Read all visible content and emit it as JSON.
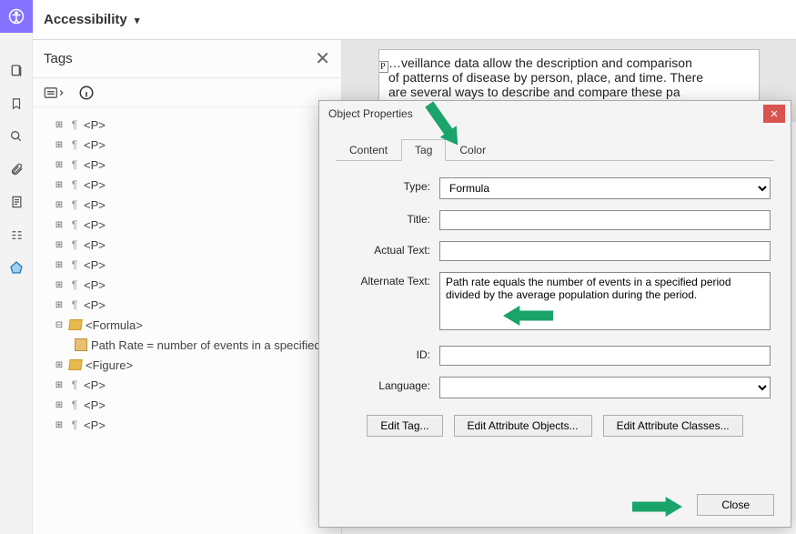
{
  "top": {
    "title": "Accessibility"
  },
  "tags_panel": {
    "heading": "Tags",
    "items": [
      {
        "kind": "p",
        "label": "<P>"
      },
      {
        "kind": "p",
        "label": "<P>"
      },
      {
        "kind": "p",
        "label": "<P>"
      },
      {
        "kind": "p",
        "label": "<P>"
      },
      {
        "kind": "p",
        "label": "<P>"
      },
      {
        "kind": "p",
        "label": "<P>"
      },
      {
        "kind": "p",
        "label": "<P>"
      },
      {
        "kind": "p",
        "label": "<P>"
      },
      {
        "kind": "p",
        "label": "<P>"
      },
      {
        "kind": "p",
        "label": "<P>"
      },
      {
        "kind": "formula",
        "label": "<Formula>",
        "child": "Path Rate = number of events in a specified"
      },
      {
        "kind": "figure",
        "label": "<Figure>"
      },
      {
        "kind": "p",
        "label": "<P>"
      },
      {
        "kind": "p",
        "label": "<P>"
      },
      {
        "kind": "p",
        "label": "<P>"
      }
    ]
  },
  "doc": {
    "line1": "…veillance data allow the description and comparison",
    "line2": "of patterns of disease by person, place, and time.   There",
    "line3": "are several ways to describe and compare these pa",
    "ptag": "P"
  },
  "dialog": {
    "title": "Object Properties",
    "tabs": {
      "content": "Content",
      "tag": "Tag",
      "color": "Color"
    },
    "labels": {
      "type": "Type:",
      "title": "Title:",
      "actual": "Actual Text:",
      "alt": "Alternate Text:",
      "id": "ID:",
      "lang": "Language:"
    },
    "values": {
      "type": "Formula",
      "title": "",
      "actual": "",
      "alt": "Path rate equals the number of events in a specified period divided by the average population during the period.",
      "id": "",
      "lang": ""
    },
    "buttons": {
      "edit_tag": "Edit Tag...",
      "edit_attr_obj": "Edit Attribute Objects...",
      "edit_attr_cls": "Edit Attribute Classes...",
      "close": "Close"
    }
  }
}
